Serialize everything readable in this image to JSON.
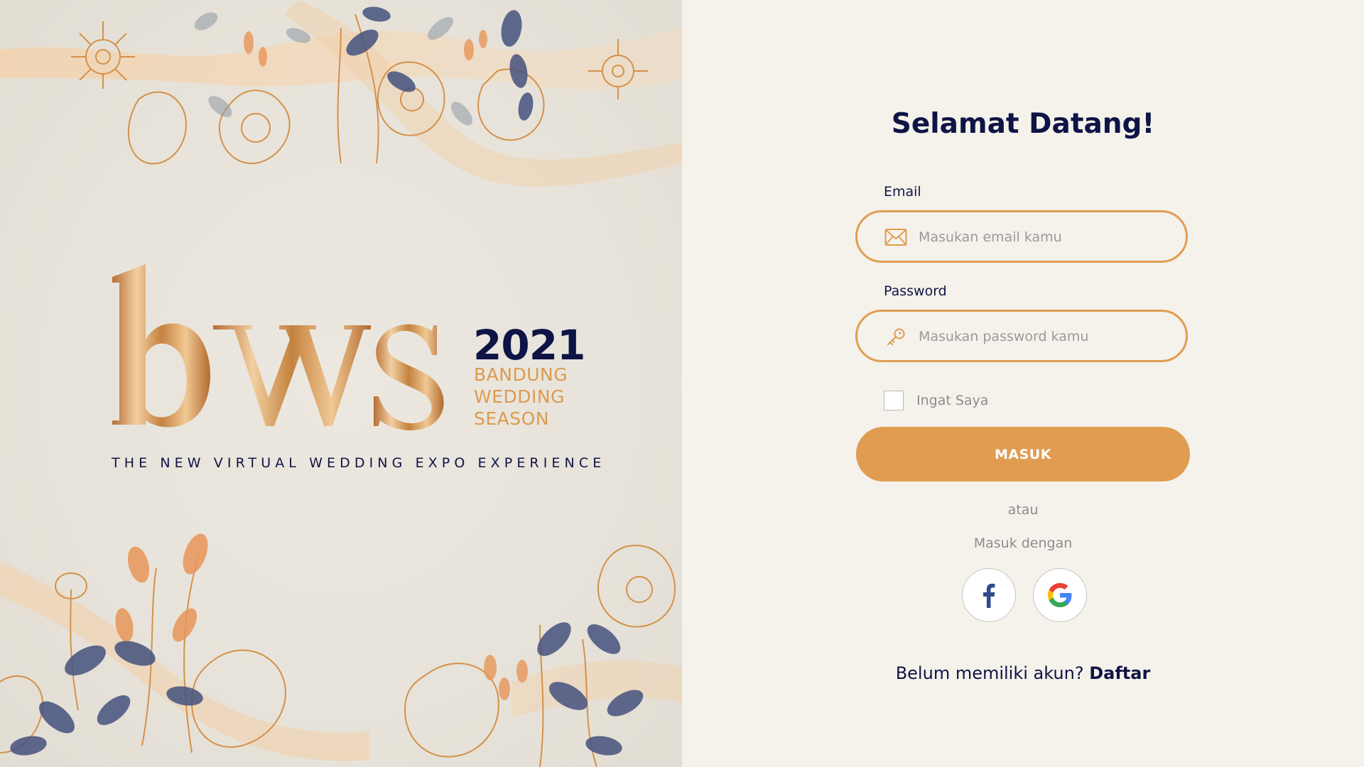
{
  "branding": {
    "logo_text": "bws",
    "year": "2021",
    "subtitle_lines": [
      "BANDUNG",
      "WEDDING",
      "SEASON"
    ],
    "tagline": "THE NEW VIRTUAL WEDDING EXPO EXPERIENCE"
  },
  "login": {
    "title": "Selamat Datang!",
    "email": {
      "label": "Email",
      "placeholder": "Masukan email kamu",
      "icon": "envelope-icon"
    },
    "password": {
      "label": "Password",
      "placeholder": "Masukan password kamu",
      "icon": "key-icon"
    },
    "remember_me": {
      "label": "Ingat Saya",
      "checked": false
    },
    "submit_label": "MASUK",
    "divider_text": "atau",
    "social_prompt": "Masuk dengan",
    "social": [
      {
        "name": "facebook",
        "icon": "facebook-icon"
      },
      {
        "name": "google",
        "icon": "google-icon"
      }
    ],
    "signup": {
      "prompt": "Belum memiliki akun?",
      "link_label": "Daftar"
    }
  },
  "colors": {
    "accent": "#e09d52",
    "navy": "#0f1446",
    "background": "#f5f2eb",
    "muted_text": "#8d8d8d"
  }
}
